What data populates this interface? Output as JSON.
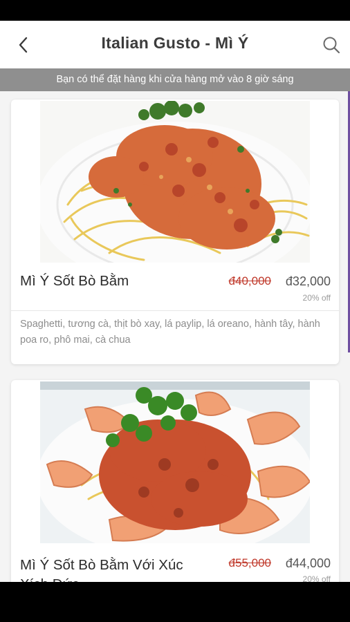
{
  "header": {
    "title": "Italian Gusto - Mì Ý",
    "back_icon": "chevron-left-icon",
    "search_icon": "search-icon"
  },
  "notice": {
    "text": "Bạn có thể đặt hàng khi cửa hàng mở vào 8 giờ sáng"
  },
  "menu_items": [
    {
      "name": "Mì Ý Sốt Bò Bằm",
      "old_price": "đ40,000",
      "price": "đ32,000",
      "discount": "20% off",
      "description": "Spaghetti, tương cà, thịt bò xay, lá paylip, lá oreano, hành tây, hành poa ro, phô mai, cà chua"
    },
    {
      "name_line1": "Mì Ý Sốt Bò Bằm Với Xúc",
      "name_line2": "Xích Đức",
      "old_price": "đ55,000",
      "price": "đ44,000",
      "discount": "20% off"
    }
  ],
  "colors": {
    "notice_bg": "#8f8f8f",
    "old_price": "#c0392b",
    "scroll_indicator": "#6e4ea0"
  }
}
